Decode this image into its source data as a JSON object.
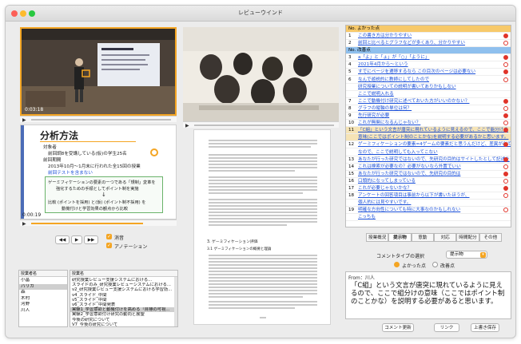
{
  "window": {
    "title": "レビューウインド"
  },
  "colors": {
    "accent": "#f4a523",
    "link": "#1a4fd8",
    "good_header": "#f7c96a",
    "bad_header": "#8fc0ee",
    "highlight_row": "#f6e4b6",
    "marker_red": "#e0342a"
  },
  "video1": {
    "time": "0:03:18"
  },
  "video2": {
    "time": ""
  },
  "slide": {
    "heading": "分析方法",
    "bullets": [
      "対象者",
      "前回調8を受講している(仮)の学生25名",
      "前回期間",
      "2013年10月〜1月末に行われた全15回の授業",
      "前回テストを含まない"
    ],
    "lower": [
      "ゲーミフィケーションの要素の一つである「規制」変革を",
      "強化するための手順としてポイント制を実施",
      "比較 (ポイントを採用) と(仮) (ポイント制不採用) を",
      "動機付けと学習効果の観点から比較"
    ],
    "time": "0:00:19"
  },
  "doc": {
    "section1": "3. ゲーミフィケーション評価",
    "section2": "3.1 ゲーミフィケーションの概要と理論"
  },
  "controls": {
    "prev": "◀◀",
    "play": "▶",
    "next": "▶▶",
    "sound_label": "消音",
    "annotation_label": "アノテーション"
  },
  "people_list": {
    "header": "授業者名",
    "items": [
      "小畠",
      "バリガ",
      "森",
      "木村",
      "河野",
      "川人"
    ]
  },
  "lesson_list": {
    "header": "授業名",
    "items": [
      "研究授業レビュー支援システムにおける...",
      "スライドのみ_研究授業レビューシステムにおける...",
      "v2_研究授業レビュー支援システムにおける学習効...",
      "v4_スライド_中間",
      "v5_スライド_中間",
      "v6_スライド_中間発表",
      "実験1_学習意欲と動機付けを高める「目標の可視...",
      "実験2_学習意欲付け研究の動向と展望",
      "今後の研究について",
      "V7_今後の研究について"
    ]
  },
  "comments": {
    "good_header": "No. よかった点",
    "good": [
      {
        "no": "1",
        "text": "この書き方は分かりやすい"
      },
      {
        "no": "2",
        "text": "前回と比べるとグラフなどが多くあり、分かりやすい"
      }
    ],
    "bad_header": "No. 改善点",
    "bad": [
      {
        "no": "3",
        "text": "a「よ」と「ょ」が「○」「ように」"
      },
      {
        "no": "4",
        "text": "2021年4月から〜という"
      },
      {
        "no": "5",
        "text": "すでにページを遷移するなら この目次のページは必要ない"
      },
      {
        "no": "6",
        "text": "なんで遊説的に教師にしてしたので"
      },
      {
        "no": "",
        "text": "研究授業についての説明が書いてありかもしない"
      },
      {
        "no": "",
        "text": "ここで説明入れる"
      },
      {
        "no": "7",
        "text": "ここで動機付け研究に述べておいた方がいいのかない？"
      },
      {
        "no": "8",
        "text": "グラフの縦軸の単位は何？"
      },
      {
        "no": "9",
        "text": "先行研究が必要"
      },
      {
        "no": "10",
        "text": "これが無関になるんじゃない？"
      },
      {
        "no": "11",
        "text": "「C組」という文言が唐突に現れているように見えるので、ここで能分けの"
      },
      {
        "no": "",
        "text": "意味(ここではポイント制のことかな)を説明する必要があるかと思います。"
      },
      {
        "no": "12",
        "text": "ゲーミフィケーションの要素=4ゲームの要素だと思うんだけど、差異が出てる"
      },
      {
        "no": "",
        "text": "なので、ここで説明しても入ってこない"
      },
      {
        "no": "13",
        "text": "あなたが行った研究ではないので、先研究の目的はサイトしたとして記述を"
      },
      {
        "no": "14",
        "text": "これは検索が必要なの？必要がないなら外置でいい"
      },
      {
        "no": "15",
        "text": "あなたが行った研究ではないので、先研究の目的は"
      },
      {
        "no": "16",
        "text": "口頭的になってしまっている"
      },
      {
        "no": "17",
        "text": "これが必要じゃないかな？"
      },
      {
        "no": "18",
        "text": "アンケートの回答項目は事前から以下が書いたほうが、"
      },
      {
        "no": "",
        "text": "個人的には見やすいです。"
      },
      {
        "no": "19",
        "text": "明確な方向性についても特に大事なのかもしれない"
      },
      {
        "no": "",
        "text": "こっちも"
      }
    ]
  },
  "tabs": [
    "授業概況",
    "提示物",
    "意動",
    "対応",
    "時間配分",
    "その他"
  ],
  "comment_type": {
    "label": "コメントタイプの選択",
    "selected": "提示物",
    "good": "よかった点",
    "bad": "改善点"
  },
  "detail": {
    "from": "From：川人",
    "text": "「C組」という文言が唐突に現れているように見えるので、ここで組分けの意味（ここではポイント制のことかな）を説明する必要があると思います。"
  },
  "buttons": {
    "update": "コメント更新",
    "link": "リンク",
    "save": "上書き保存"
  }
}
